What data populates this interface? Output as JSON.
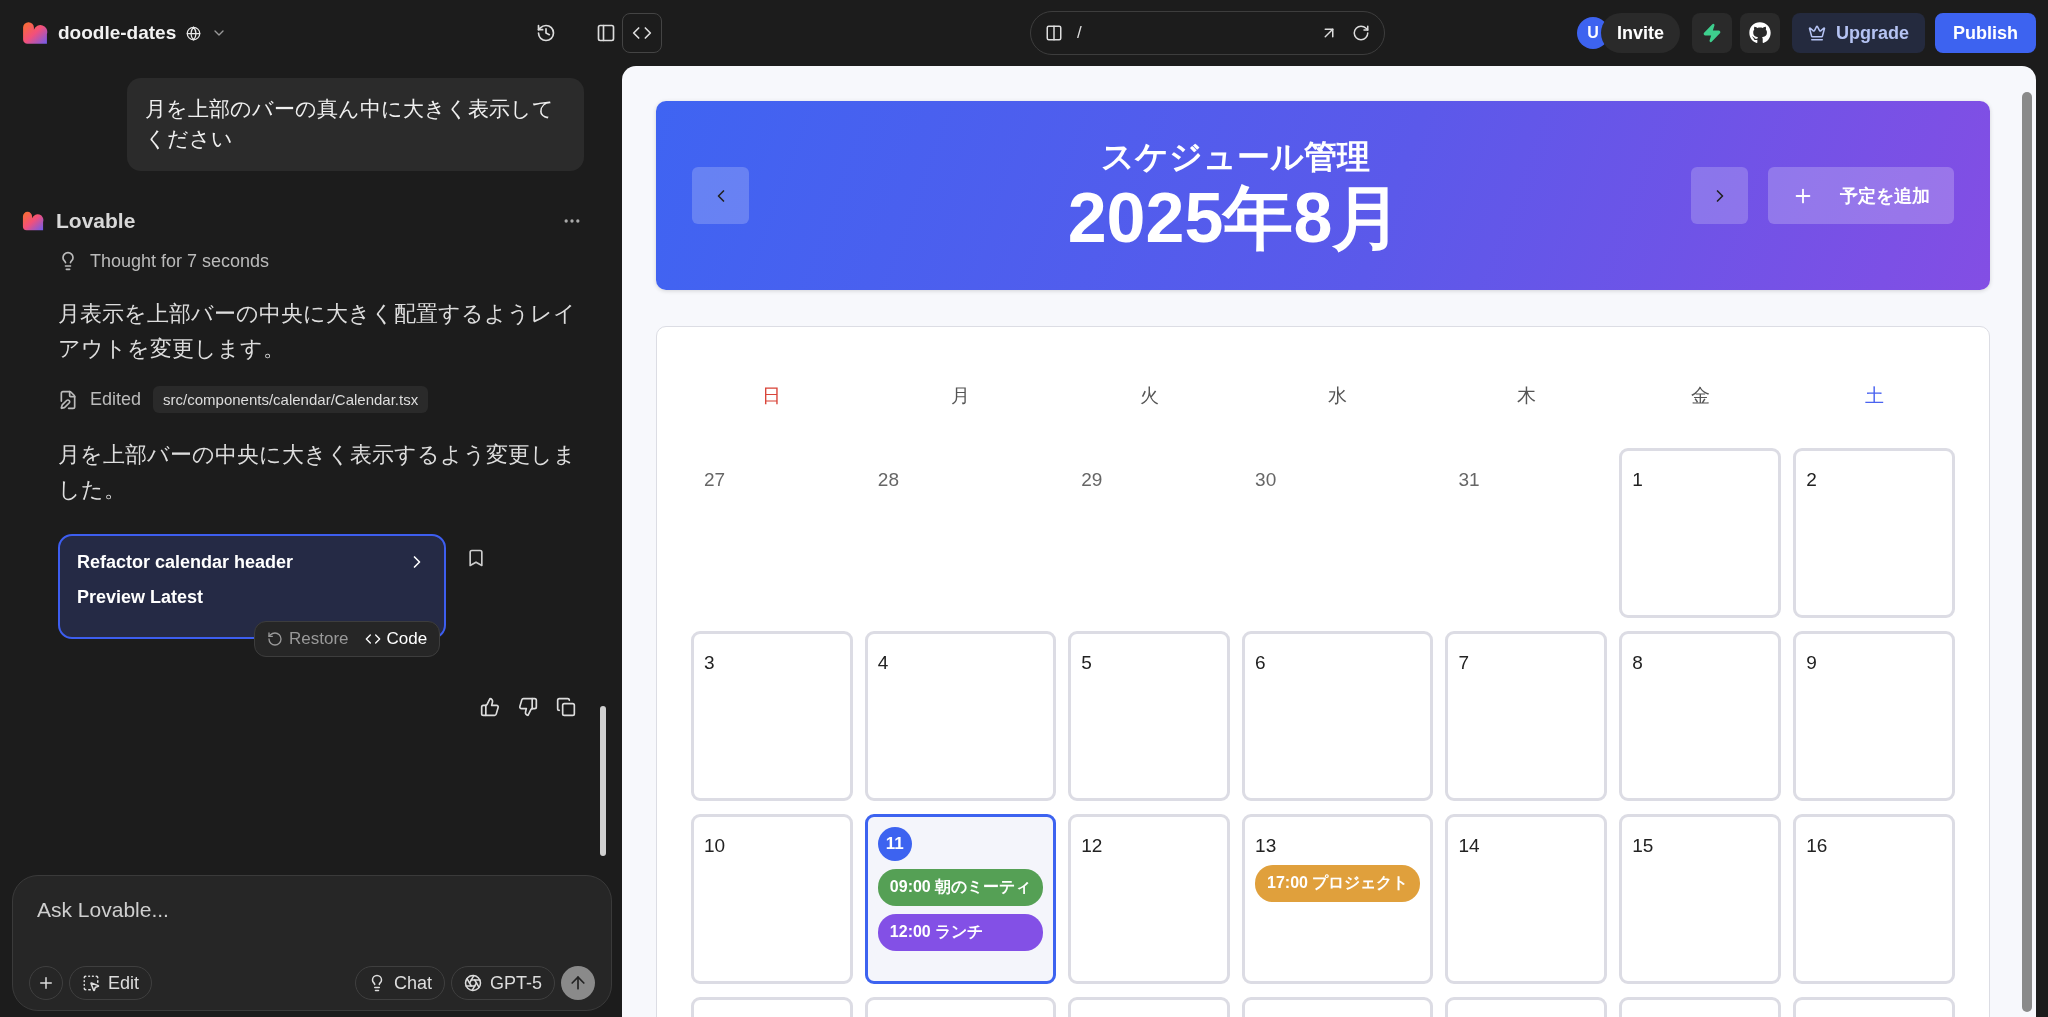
{
  "project": {
    "name": "doodle-dates"
  },
  "url_bar": {
    "path": "/"
  },
  "top_actions": {
    "avatar": "U",
    "invite": "Invite",
    "upgrade": "Upgrade",
    "publish": "Publish"
  },
  "chat": {
    "user_message": "月を上部のバーの真ん中に大きく表示してください",
    "assistant": {
      "name": "Lovable",
      "thought": "Thought for 7 seconds",
      "message": "月表示を上部バーの中央に大きく配置するようレイアウトを変更します。",
      "edited_label": "Edited",
      "edited_file": "src/components/calendar/Calendar.tsx",
      "summary": "月を上部バーの中央に大きく表示するよう変更しました。",
      "version_card": {
        "title": "Refactor calendar header",
        "subtitle": "Preview Latest"
      },
      "version_actions": [
        {
          "label": "Restore",
          "kind": "restore"
        },
        {
          "label": "Code",
          "kind": "code"
        }
      ]
    }
  },
  "composer": {
    "placeholder": "Ask Lovable...",
    "edit": "Edit",
    "mode": "Chat",
    "model": "GPT-5"
  },
  "calendar": {
    "title": "スケジュール管理",
    "month": "2025年8月",
    "add_button": "予定を追加",
    "weekdays": [
      {
        "label": "日",
        "kind": "sunday"
      },
      {
        "label": "月",
        "kind": "weekday"
      },
      {
        "label": "火",
        "kind": "weekday"
      },
      {
        "label": "水",
        "kind": "weekday"
      },
      {
        "label": "木",
        "kind": "weekday"
      },
      {
        "label": "金",
        "kind": "weekday"
      },
      {
        "label": "土",
        "kind": "saturday"
      }
    ],
    "weeks": [
      [
        {
          "day": "27",
          "kind": "outside"
        },
        {
          "day": "28",
          "kind": "outside"
        },
        {
          "day": "29",
          "kind": "outside"
        },
        {
          "day": "30",
          "kind": "outside"
        },
        {
          "day": "31",
          "kind": "outside"
        },
        {
          "day": "1",
          "kind": "current"
        },
        {
          "day": "2",
          "kind": "current"
        }
      ],
      [
        {
          "day": "3",
          "kind": "current"
        },
        {
          "day": "4",
          "kind": "current"
        },
        {
          "day": "5",
          "kind": "current"
        },
        {
          "day": "6",
          "kind": "current"
        },
        {
          "day": "7",
          "kind": "current"
        },
        {
          "day": "8",
          "kind": "current"
        },
        {
          "day": "9",
          "kind": "current"
        }
      ],
      [
        {
          "day": "10",
          "kind": "current"
        },
        {
          "day": "11",
          "kind": "today",
          "events": [
            {
              "time": "09:00",
              "title": "朝のミーティ",
              "color": "#55a055"
            },
            {
              "time": "12:00",
              "title": "ランチ",
              "color": "#8350e6"
            }
          ]
        },
        {
          "day": "12",
          "kind": "current"
        },
        {
          "day": "13",
          "kind": "current",
          "events": [
            {
              "time": "17:00",
              "title": "プロジェクト",
              "color": "#e0a03c"
            }
          ]
        },
        {
          "day": "14",
          "kind": "current"
        },
        {
          "day": "15",
          "kind": "current"
        },
        {
          "day": "16",
          "kind": "current"
        }
      ]
    ]
  }
}
